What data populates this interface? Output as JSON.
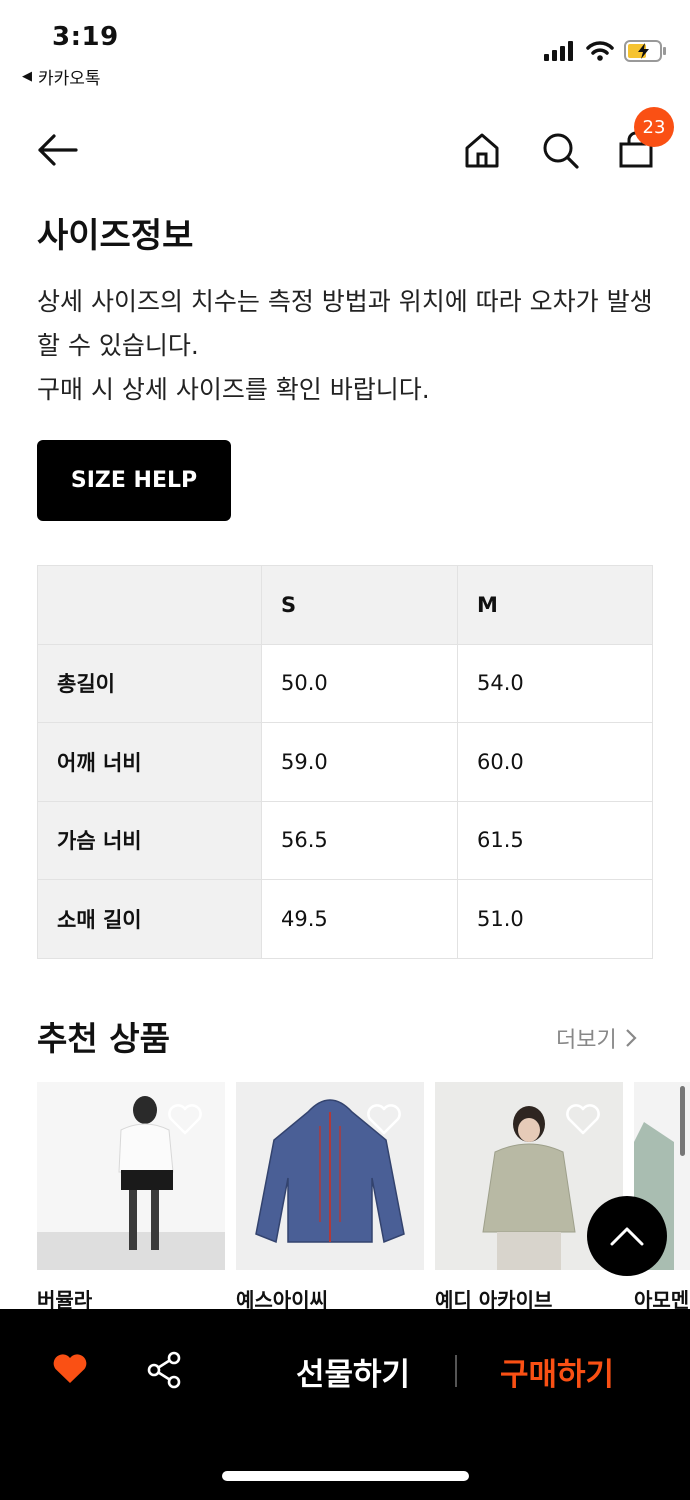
{
  "status": {
    "time": "3:19",
    "back_app": "카카오톡"
  },
  "nav": {
    "cart_count": "23"
  },
  "size_info": {
    "title": "사이즈정보",
    "desc_line1": "상세 사이즈의 치수는 측정 방법과 위치에 따라 오차가 발생할 수 있습니다.",
    "desc_line2": "구매 시 상세 사이즈를 확인 바랍니다.",
    "help_button": "SIZE HELP"
  },
  "size_table": {
    "columns": [
      "S",
      "M"
    ],
    "rows": [
      {
        "label": "총길이",
        "values": [
          "50.0",
          "54.0"
        ]
      },
      {
        "label": "어깨 너비",
        "values": [
          "59.0",
          "60.0"
        ]
      },
      {
        "label": "가슴 너비",
        "values": [
          "56.5",
          "61.5"
        ]
      },
      {
        "label": "소매 길이",
        "values": [
          "49.5",
          "51.0"
        ]
      }
    ]
  },
  "recommend": {
    "title": "추천 상품",
    "more": "더보기",
    "products": [
      {
        "brand": "버뮬라"
      },
      {
        "brand": "예스아이씨"
      },
      {
        "brand": "예디 아카이브"
      },
      {
        "brand": "아모멘"
      }
    ]
  },
  "bottom": {
    "gift": "선물하기",
    "buy": "구매하기"
  },
  "colors": {
    "accent": "#fa5014",
    "bar": "#000000"
  }
}
